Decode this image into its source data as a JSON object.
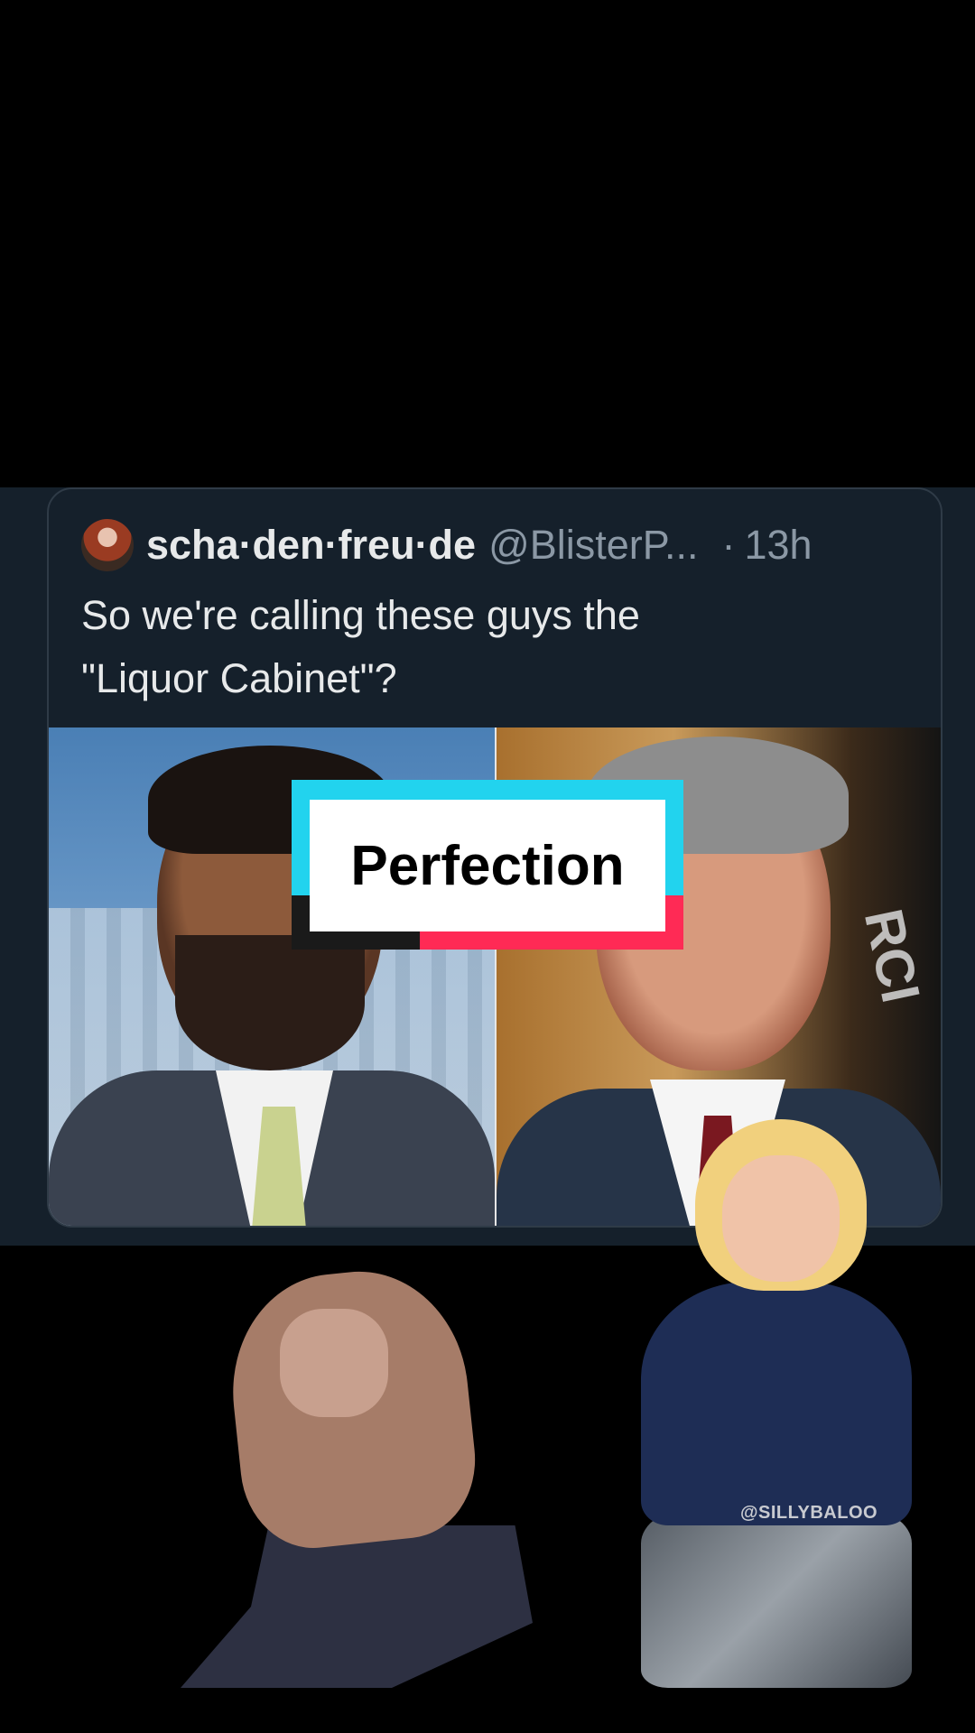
{
  "tweet": {
    "display_name": "scha·den·freu·de",
    "handle": "@BlisterP...",
    "separator": "·",
    "time": "13h",
    "text_line1": "So we're calling these guys the",
    "text_line2": "\"Liquor Cabinet\"?",
    "photo_right_text": "RCI"
  },
  "overlay": {
    "caption": "Perfection"
  },
  "watermark": "@SILLYBALOO",
  "colors": {
    "tweet_bg": "#15202b",
    "caption_cyan": "#22d3ee",
    "caption_pink": "#ff2a55"
  }
}
